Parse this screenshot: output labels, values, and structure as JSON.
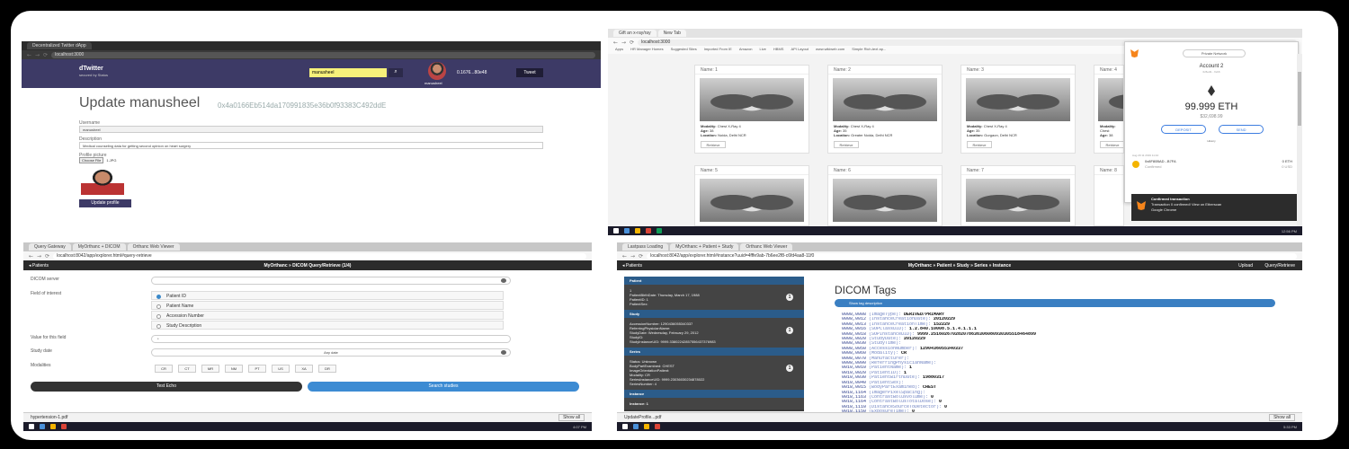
{
  "q1": {
    "tabs": [
      "Decentralized Twitter dApp"
    ],
    "url": "localhost:3000",
    "brand": "dTwitter",
    "brand_sub": "secured by Status",
    "search_value": "manusheel",
    "avatar_name": "manusheel",
    "balance": "0.1676...80e48",
    "tweet_label": "Tweet",
    "title": "Update manusheel",
    "address": "0x4a0166Eb514da170991835e36b0f93383C492ddE",
    "username_label": "Username",
    "username_value": "manusheel",
    "description_label": "Description",
    "description_value": "Medical counseling data for getting second opinion on heart surgery",
    "picture_label": "Profile picture",
    "choose_file": "Choose File",
    "file_name": "1.JPG",
    "update_button": "Update profile"
  },
  "q2": {
    "tabs": [
      "Gift an x-ray/ray",
      "New Tab"
    ],
    "url": "localhost:3000",
    "bookmarks": [
      "Apps",
      "HR Manager Homes",
      "Suggested Sites",
      "Imported From IE",
      "Amazon",
      "Live",
      "HBMS",
      "API Layout",
      "www.wikiweb.com",
      "Simple Rich-text ap..."
    ],
    "cards": [
      {
        "name": "Name: 1",
        "modality": "Chest X-Ray 4",
        "age": "38",
        "location": "Noida, Delhi NCR",
        "btn": "Retrieve"
      },
      {
        "name": "Name: 2",
        "modality": "Chest X-Ray 4",
        "age": "35",
        "location": "Greater Noida, Delhi NCR",
        "btn": "Retrieve"
      },
      {
        "name": "Name: 3",
        "modality": "Chest X-Ray 4",
        "age": "35",
        "location": "Gurgaon, Delhi NCR",
        "btn": "Retrieve"
      },
      {
        "name": "Name: 4",
        "modality": "Chest",
        "age": "38",
        "location": "",
        "btn": "Retrieve"
      },
      {
        "name": "Name: 5"
      },
      {
        "name": "Name: 6"
      },
      {
        "name": "Name: 7"
      },
      {
        "name": "Name: 8"
      }
    ],
    "labels": {
      "modality": "Modality:",
      "age": "Age:",
      "location": "Location:"
    },
    "metamask": {
      "network": "Private Network",
      "account": "Account 2",
      "address": "0x5e4b...7eb6",
      "balance": "99.999 ETH",
      "usd": "$32,698.99",
      "deposit": "DEPOSIT",
      "send": "SEND",
      "tx_date": "Aug 29 11 2019 11:44",
      "tx_name": "0x8F80BAD...B7FA",
      "tx_status": "Confirmed",
      "tx_amount": "0 ETH",
      "tx_fiat": "0 USD",
      "history_label": "History"
    },
    "toast": {
      "title": "Confirmed transaction",
      "line1": "Transaction 0 confirmed! View on Etherscan",
      "line2": "Google Chrome"
    },
    "clock": "12:56 PM"
  },
  "q3": {
    "tabs": [
      "Query Gateway",
      "MyOrthanc + DICOM",
      "Orthanc Web Viewer"
    ],
    "url": "localhost:8042/app/explorer.html#query-retrieve",
    "back": "◂ Patients",
    "title": "MyOrthanc » DICOM Query/Retrieve (1/4)",
    "labels": {
      "server": "DICOM server",
      "field": "Field of interest",
      "value": "Value for this field",
      "date": "Study date",
      "modalities": "Modalities"
    },
    "fields": [
      "Patient ID",
      "Patient Name",
      "Accession Number",
      "Study Description"
    ],
    "value_placeholder": "*",
    "date_value": "Any date",
    "modalities": [
      "CR",
      "CT",
      "MR",
      "NM",
      "PT",
      "US",
      "XA",
      "DR"
    ],
    "test_button": "Test Echo",
    "search_button": "Search studies",
    "download": "hypertension-1.pdf",
    "show_all": "Show all",
    "clock": "4:07 PM"
  },
  "q4": {
    "tabs": [
      "Lastpass Loading",
      "MyOrthanc + Patient + Study",
      "Orthanc Web Viewer"
    ],
    "url": "localhost:8042/app/explorer.html#instance?uuid=4fffe9ab-7b6ee2f8-c6fd4aa8-11f0",
    "back": "◂ Patients",
    "title": "MyOrthanc » Patient » Study » Series » Instance",
    "upload": "Upload",
    "query": "Query/Retrieve",
    "left": {
      "patient_head": "Patient",
      "patient_lines": [
        "1",
        "PatientBirthDate: Thursday, March 17, 1988",
        "PatientID: 1",
        "PatientSex:"
      ],
      "patient_count": "1",
      "study_head": "Study",
      "study_lines": [
        "AccessionNumber: 1290436055340337",
        "ReferringPhysicianName:",
        "StudyDate: Wednesday, February 29, 2012",
        "StudyID:",
        "StudyInstanceUID: 9999.33802242857556437376983"
      ],
      "study_count": "1",
      "series_head": "Series",
      "series_lines": [
        "Status: Unknown",
        "BodyPartExamined: CHEST",
        "ImageOrientationPatient:",
        "Modality: CR",
        "SeriesInstanceUID: 9999.23036030234878022",
        "SeriesNumber: 4"
      ],
      "series_count": "1",
      "instance_head": "Instance",
      "instance_lines": [
        "Instance: 1"
      ]
    },
    "tags_title": "DICOM Tags",
    "tags_button": "Show tag description",
    "tags": [
      [
        "0008,0008",
        "ImageType",
        "DERIVED/PRIMARY"
      ],
      [
        "0008,0012",
        "InstanceCreationDate",
        "20120229"
      ],
      [
        "0008,0013",
        "InstanceCreationTime",
        "152229"
      ],
      [
        "0008,0016",
        "SOPClassUID",
        "1.2.840.10008.5.1.4.1.1.1"
      ],
      [
        "0008,0018",
        "SOPInstanceUID",
        "9999.251602670282078636306080930305518464899"
      ],
      [
        "0008,0020",
        "StudyDate",
        "20120229"
      ],
      [
        "0008,0030",
        "StudyTime",
        ""
      ],
      [
        "0008,0050",
        "AccessionNumber",
        "1290436055340337"
      ],
      [
        "0008,0060",
        "Modality",
        "CR"
      ],
      [
        "0008,0070",
        "Manufacturer",
        ""
      ],
      [
        "0008,0090",
        "ReferringPhysicianName",
        ""
      ],
      [
        "0010,0010",
        "PatientName",
        "1"
      ],
      [
        "0010,0020",
        "PatientID",
        "1"
      ],
      [
        "0010,0030",
        "PatientBirthDate",
        "19880317"
      ],
      [
        "0010,0040",
        "PatientSex",
        ""
      ],
      [
        "0018,0015",
        "BodyPartExamined",
        "CHEST"
      ],
      [
        "0018,1164",
        "ImagerPixelSpacing",
        ""
      ],
      [
        "0018,1163",
        "ContrastBolusVolume",
        "0"
      ],
      [
        "0018,1164",
        "ContrastBolusTotalDose",
        "0"
      ],
      [
        "0018,1110",
        "DistanceSourceToDetector",
        "0"
      ],
      [
        "0018,1150",
        "ExposureTime",
        "0"
      ]
    ],
    "download": "UpdateProfile...pdf",
    "show_all": "Show all",
    "clock": "5:33 PM"
  }
}
